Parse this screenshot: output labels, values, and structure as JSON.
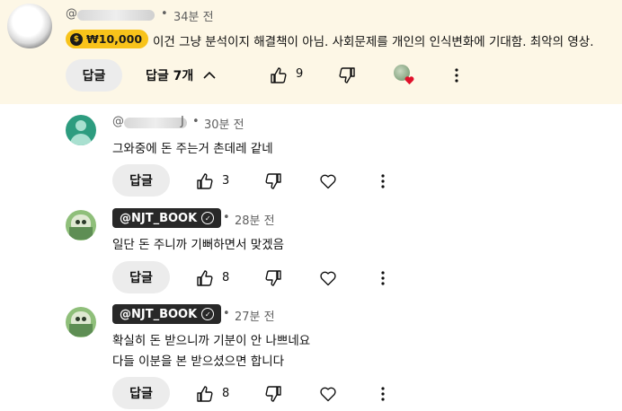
{
  "top_comment": {
    "author": "@",
    "separator": "•",
    "time": "34분 전",
    "super_thanks": "₩10,000",
    "text": "이건 그냥 분석이지 해결책이 아님. 사회문제를 개인의 인식변화에 기대함. 최악의 영상.",
    "reply_label": "답글",
    "replies_toggle": "답글 7개",
    "likes": "9"
  },
  "replies": [
    {
      "author": "@",
      "author_tail": "J",
      "separator": "•",
      "time": "30분 전",
      "lines": [
        "그와중에 돈 주는거 촌데레 같네"
      ],
      "reply_label": "답글",
      "likes": "3"
    },
    {
      "author": "@NJT_BOOK",
      "separator": "•",
      "time": "28분 전",
      "lines": [
        "일단 돈 주니까 기뻐하면서 맞겠음"
      ],
      "reply_label": "답글",
      "likes": "8"
    },
    {
      "author": "@NJT_BOOK",
      "separator": "•",
      "time": "27분 전",
      "lines": [
        "확실히 돈 받으니까 기분이 안 나쁘네요",
        "다들 이분을 본 받으셨으면 합니다"
      ],
      "reply_label": "답글",
      "likes": "8"
    }
  ],
  "icons": {
    "like": "thumbs-up-icon",
    "dislike": "thumbs-down-icon",
    "heart": "heart-outline-icon",
    "more": "more-vert-icon",
    "chevron": "chevron-up-icon"
  },
  "colors": {
    "highlight_bg": "#fdf7e6",
    "super_thanks": "#f8c31a",
    "creator_heart": "#e0102a"
  }
}
